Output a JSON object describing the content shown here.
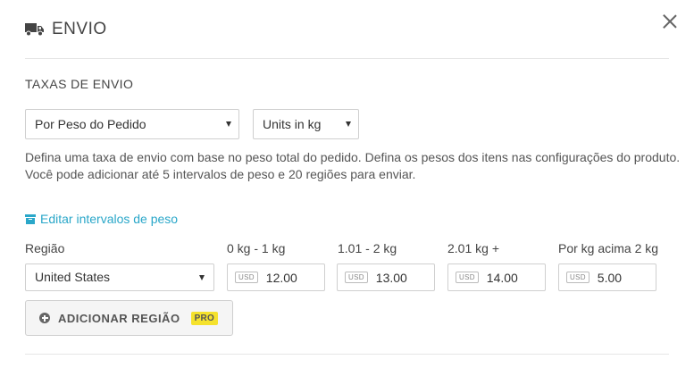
{
  "modal": {
    "title": "ENVIO",
    "header_icon": "truck-icon",
    "close_icon": "close-icon"
  },
  "shipping_rates": {
    "section_title": "TAXAS DE ENVIO",
    "rate_type_select": {
      "value": "Por Peso do Pedido"
    },
    "units_select": {
      "value": "Units in kg"
    },
    "description_line1": "Defina uma taxa de envio com base no peso total do pedido. Defina os pesos dos itens nas configurações do produto.",
    "description_line2": "Você pode adicionar até 5 intervalos de peso e 20 regiões para enviar.",
    "edit_link": {
      "label": "Editar intervalos de peso",
      "icon": "box-icon",
      "color": "#2aa7c9"
    }
  },
  "table": {
    "headers": {
      "region": "Região",
      "range1": "0 kg - 1 kg",
      "range2": "1.01 - 2 kg",
      "range3": "2.01 kg +",
      "range4": "Por kg acima 2 kg"
    },
    "row": {
      "region": "United States",
      "currency": "USD",
      "rate1": "12.00",
      "rate2": "13.00",
      "rate3": "14.00",
      "rate4": "5.00"
    }
  },
  "add_region": {
    "label": "ADICIONAR REGIÃO",
    "badge": "PRO",
    "badge_color": "#f5e22d",
    "icon": "plus-circle-icon"
  }
}
